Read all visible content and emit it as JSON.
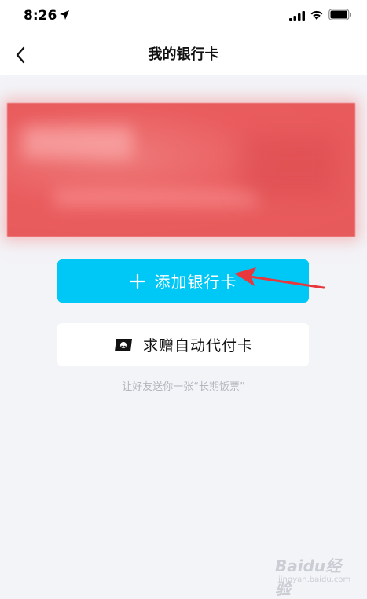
{
  "status_bar": {
    "time": "8:26",
    "icons": [
      "location-arrow-icon",
      "cellular-signal-icon",
      "wifi-icon",
      "battery-icon"
    ]
  },
  "nav": {
    "title": "我的银行卡",
    "back_icon": "chevron-left-icon"
  },
  "card": {
    "color": "#e85f60",
    "state": "blurred"
  },
  "actions": {
    "add_card_label": "添加银行卡",
    "add_card_icon": "plus-icon",
    "add_card_color": "#00c8f6",
    "gift_card_label": "求赠自动代付卡",
    "gift_card_icon": "ticket-icon",
    "gift_hint": "让好友送你一张“长期饭票”"
  },
  "annotation": {
    "arrow_color": "#e8383d"
  },
  "watermark": {
    "text": "Baidu经验",
    "sub": "jingyan.baidu.com"
  }
}
